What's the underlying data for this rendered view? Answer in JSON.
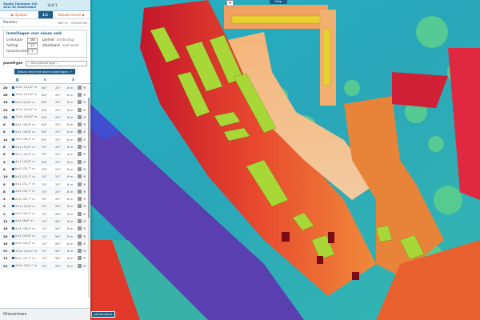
{
  "app": {
    "address_line1": "Studio Tuinbouw 140",
    "address_line2": "1011 KC Amsterdam",
    "unit": "Unit 1"
  },
  "tabs": {
    "left": "Opslaan",
    "mid": "1/1",
    "right": "Nieuwe versie"
  },
  "summary": {
    "label": "Panelen",
    "value1": "987 m",
    "value2": "29/165 Mp"
  },
  "settings": {
    "title": "Instellingen voor nieuw veld",
    "orientation_label": "oriëntatie",
    "orientation_value": "180",
    "tilt_label": "helling",
    "tilt_value": "15",
    "spacing_label": "tussenruimte",
    "spacing_value": "2",
    "option1": "portret",
    "option1_alt": "landschap",
    "option2": "standaard",
    "option2_alt": "oost-west",
    "paneltype_label": "paneltype",
    "paneltype_placeholder": "-- Kies paneel type --",
    "new_field_button": "Nieuw veld met deze instellingen"
  },
  "table": {
    "rows": [
      {
        "n": "20",
        "dims": "13×2 141,8° m",
        "tilt": "60°",
        "orient": "25°",
        "m": "6 m"
      },
      {
        "n": "26",
        "dims": "13×2 141,8° m",
        "tilt": "60°",
        "orient": "25°",
        "m": "6 m"
      },
      {
        "n": "10",
        "dims": "5×2 141,8° m",
        "tilt": "60°",
        "orient": "25°",
        "m": "6 m"
      },
      {
        "n": "24",
        "dims": "12×2 141,8° m",
        "tilt": "60°",
        "orient": "25°",
        "m": "6 m"
      },
      {
        "n": "34",
        "dims": "17×2 140,6° m",
        "tilt": "60°",
        "orient": "25°",
        "m": "6 m"
      },
      {
        "n": "8",
        "dims": "4×2 140,8° m",
        "tilt": "60°",
        "orient": "25°",
        "m": "6 m"
      },
      {
        "n": "8",
        "dims": "4×2 140,6° m",
        "tilt": "60°",
        "orient": "25°",
        "m": "6 m"
      },
      {
        "n": "14",
        "dims": "7×2 140,4° m",
        "tilt": "60°",
        "orient": "25°",
        "m": "6 m"
      },
      {
        "n": "8",
        "dims": "4×1 152,8° m",
        "tilt": "35°",
        "orient": "25°",
        "m": "6 m"
      },
      {
        "n": "8",
        "dims": "4×1 142,9° m",
        "tilt": "35°",
        "orient": "25°",
        "m": "6 m"
      },
      {
        "n": "4",
        "dims": "4×1 140,8° m",
        "tilt": "60°",
        "orient": "25°",
        "m": "6 m"
      },
      {
        "n": "6",
        "dims": "6×2 233,7° m",
        "tilt": "35°",
        "orient": "25°",
        "m": "6 m"
      },
      {
        "n": "10",
        "dims": "5×2 231,7° m",
        "tilt": "35°",
        "orient": "25°",
        "m": "6 m"
      },
      {
        "n": "8",
        "dims": "4×2 231,7° m",
        "tilt": "35°",
        "orient": "25°",
        "m": "6 m"
      },
      {
        "n": "8",
        "dims": "4×2 232,7° m",
        "tilt": "35°",
        "orient": "25°",
        "m": "6 m"
      },
      {
        "n": "4",
        "dims": "2×2 232,7° m",
        "tilt": "35°",
        "orient": "25°",
        "m": "6 m"
      },
      {
        "n": "3",
        "dims": "3×1 142,8° m",
        "tilt": "15°",
        "orient": "90°",
        "m": "6 m"
      },
      {
        "n": "2",
        "dims": "2×1 141,1° m",
        "tilt": "15°",
        "orient": "90°",
        "m": "6 m"
      },
      {
        "n": "12",
        "dims": "4×4 56,6° m",
        "tilt": "15°",
        "orient": "90°",
        "m": "6 m"
      },
      {
        "n": "16",
        "dims": "4×4 236,9° m",
        "tilt": "15°",
        "orient": "90°",
        "m": "6 m"
      },
      {
        "n": "20",
        "dims": "5×4 234,8° m",
        "tilt": "15°",
        "orient": "90°",
        "m": "6 m"
      },
      {
        "n": "16",
        "dims": "4×4 224,4° m",
        "tilt": "15°",
        "orient": "90°",
        "m": "6 m"
      },
      {
        "n": "91",
        "dims": "13×5 224,0° m",
        "tilt": "15°",
        "orient": "90°",
        "m": "6 m"
      },
      {
        "n": "12",
        "dims": "6×2 147,1° m",
        "tilt": "15°",
        "orient": "90°",
        "m": "6 m"
      },
      {
        "n": "22",
        "dims": "11×2 149,1° m",
        "tilt": "15°",
        "orient": "90°",
        "m": "6 m"
      }
    ]
  },
  "footer": {
    "label": "Omvormers"
  },
  "map": {
    "help_label": "Help",
    "zoom_label": "+",
    "performance_label": "performance"
  }
}
